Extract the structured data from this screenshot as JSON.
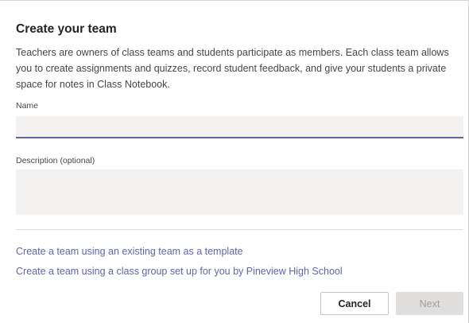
{
  "dialog": {
    "title": "Create your team",
    "description": "Teachers are owners of class teams and students participate as members. Each class team allows you to create assignments and quizzes, record student feedback, and give your students a private space for notes in Class Notebook."
  },
  "form": {
    "name_label": "Name",
    "name_value": "",
    "description_label": "Description (optional)",
    "description_value": ""
  },
  "links": {
    "template": "Create a team using an existing team as a template",
    "class_group": "Create a team using a class group set up for you by Pineview High School"
  },
  "actions": {
    "cancel_label": "Cancel",
    "next_label": "Next",
    "next_enabled": false
  },
  "colors": {
    "accent": "#6264a7",
    "input_background": "#f3f2f1",
    "disabled_button": "#e1dfdd"
  }
}
